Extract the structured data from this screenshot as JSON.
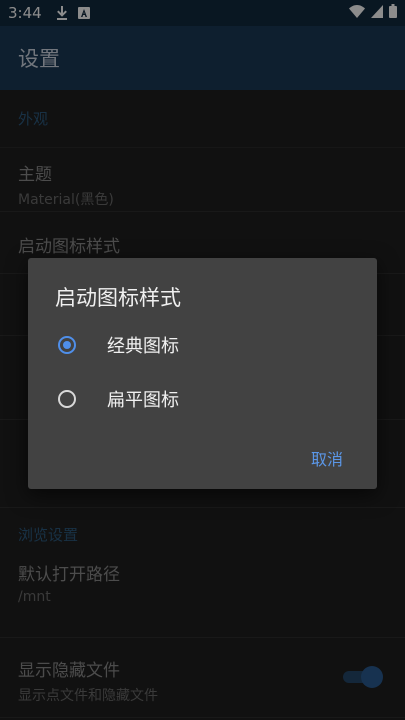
{
  "status_bar": {
    "time": "3:44",
    "icons": [
      "download-icon",
      "notification-a-icon",
      "wifi-icon",
      "signal-icon",
      "battery-icon"
    ]
  },
  "app_bar": {
    "title": "设置"
  },
  "sections": {
    "appearance": "外观",
    "browse": "浏览设置"
  },
  "prefs": {
    "theme": {
      "title": "主题",
      "summary": "Material(黑色)"
    },
    "launcher_icon": {
      "title": "启动图标样式"
    },
    "default_path": {
      "title": "默认打开路径",
      "summary": "/mnt"
    },
    "show_hidden": {
      "title": "显示隐藏文件",
      "summary": "显示点文件和隐藏文件",
      "enabled": true
    }
  },
  "dialog": {
    "title": "启动图标样式",
    "options": [
      {
        "label": "经典图标",
        "selected": true
      },
      {
        "label": "扁平图标",
        "selected": false
      }
    ],
    "cancel_label": "取消"
  },
  "colors": {
    "accent": "#4f8fea",
    "app_bar": "#1a3a56",
    "status_bar": "#122a3f",
    "background": "#1f1f1f",
    "dialog": "#424242"
  }
}
